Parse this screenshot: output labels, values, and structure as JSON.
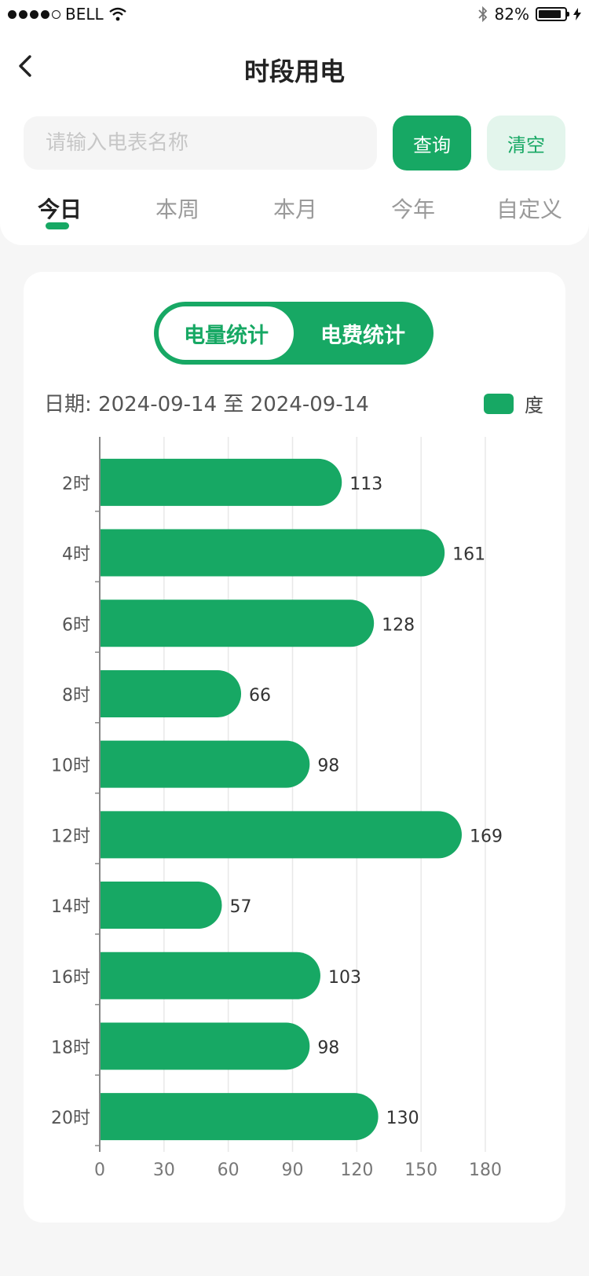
{
  "status_bar": {
    "carrier": "BELL",
    "battery": "82%",
    "signal_dots_filled": 4,
    "signal_dots_total": 5
  },
  "header": {
    "title": "时段用电",
    "back_icon": "chevron-left-icon"
  },
  "search": {
    "placeholder": "请输入电表名称",
    "value": "",
    "query_label": "查询",
    "clear_label": "清空"
  },
  "tabs": [
    {
      "label": "今日",
      "active": true
    },
    {
      "label": "本周",
      "active": false
    },
    {
      "label": "本月",
      "active": false
    },
    {
      "label": "今年",
      "active": false
    },
    {
      "label": "自定义",
      "active": false
    }
  ],
  "toggle": {
    "options": [
      "电量统计",
      "电费统计"
    ],
    "selected": 0
  },
  "date_range": {
    "label": "日期:",
    "start": "2024-09-14",
    "separator": "至",
    "end": "2024-09-14"
  },
  "colors": {
    "accent": "#17a864",
    "accent_light": "#e3f5ec"
  },
  "chart_data": {
    "type": "bar",
    "orientation": "horizontal",
    "categories": [
      "2时",
      "4时",
      "6时",
      "8时",
      "10时",
      "12时",
      "14时",
      "16时",
      "18时",
      "20时"
    ],
    "series": [
      {
        "name": "度",
        "values": [
          113,
          161,
          128,
          66,
          98,
          169,
          57,
          103,
          98,
          130
        ]
      }
    ],
    "xlim": [
      0,
      180
    ],
    "xticks": [
      0,
      30,
      60,
      90,
      120,
      150,
      180
    ],
    "legend": {
      "label": "度",
      "placement": "top-right"
    },
    "grid": true,
    "data_labels": true
  }
}
